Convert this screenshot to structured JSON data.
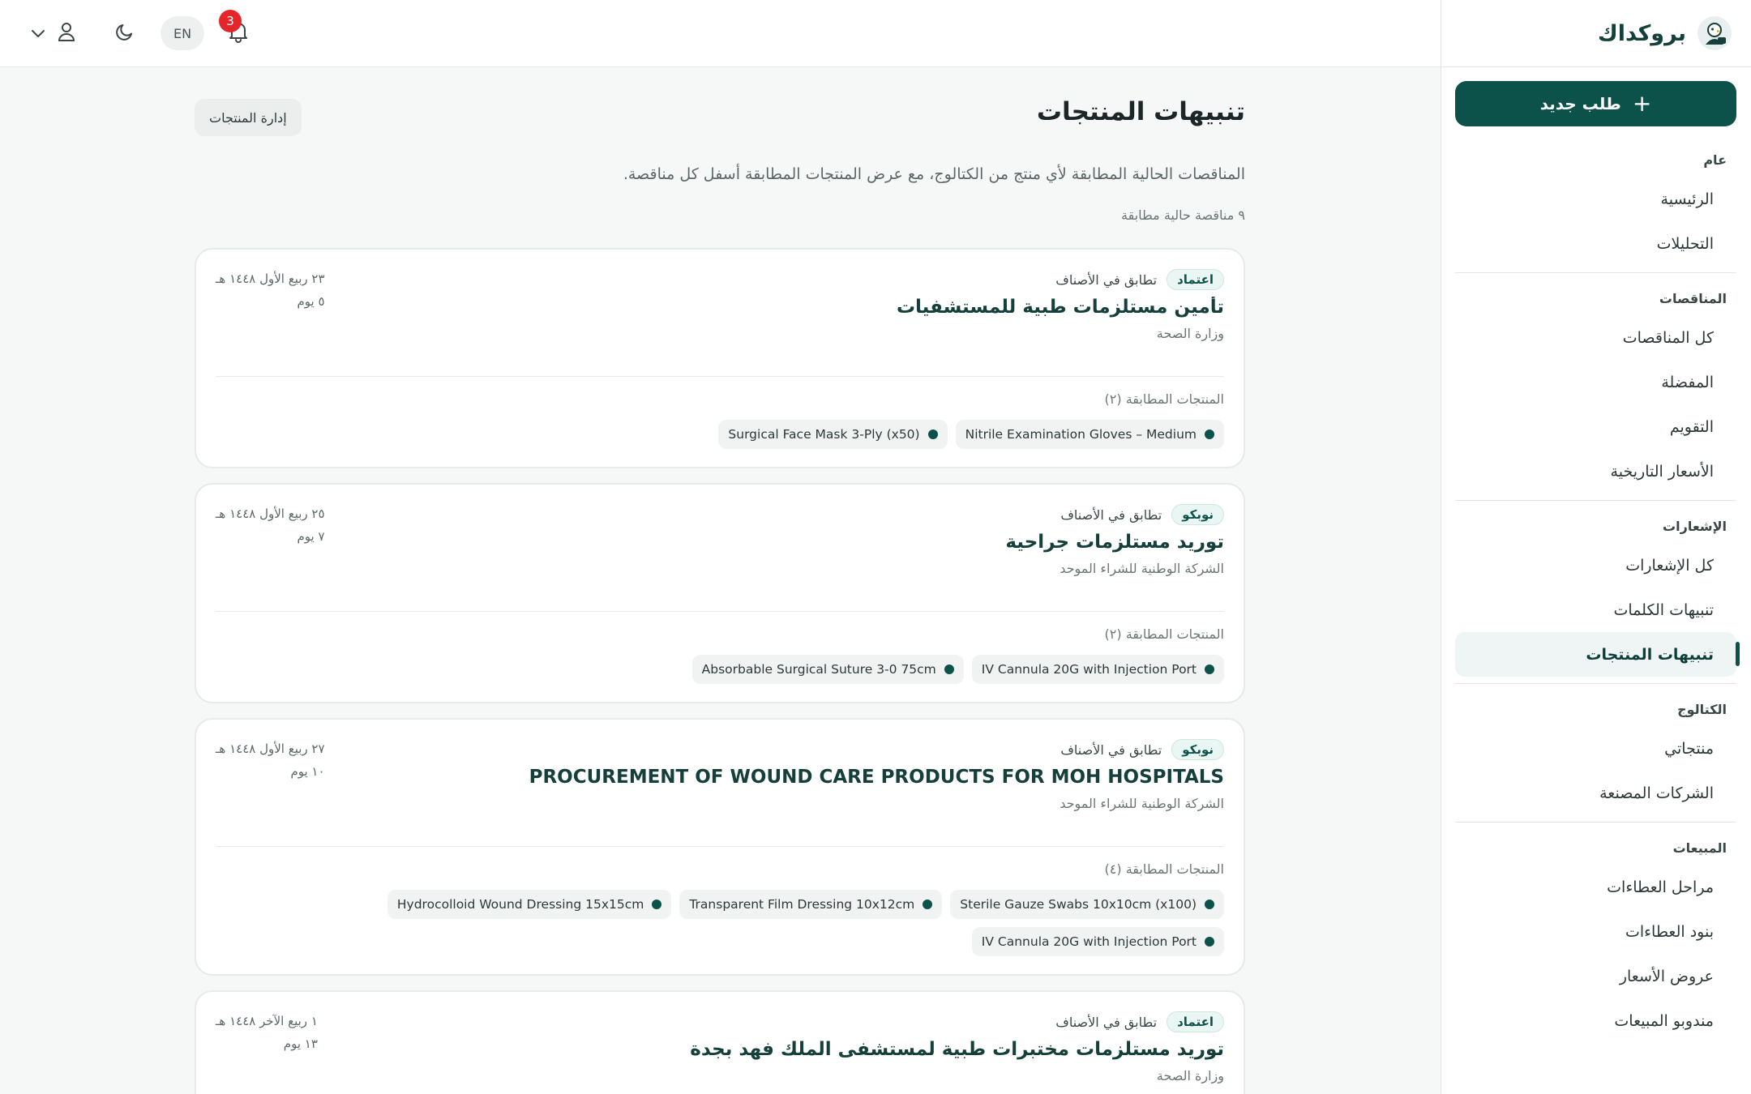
{
  "brand": {
    "name": "بروكداك"
  },
  "sidebar": {
    "new_request_label": "طلب جديد",
    "sections": [
      {
        "heading": "عام",
        "items": [
          "الرئيسية",
          "التحليلات"
        ]
      },
      {
        "heading": "المناقصات",
        "items": [
          "كل المناقصات",
          "المفضلة",
          "التقويم",
          "الأسعار التاريخية"
        ]
      },
      {
        "heading": "الإشعارات",
        "items": [
          "كل الإشعارات",
          "تنبيهات الكلمات",
          "تنبيهات المنتجات"
        ]
      },
      {
        "heading": "الكتالوج",
        "items": [
          "منتجاتي",
          "الشركات المصنعة"
        ]
      },
      {
        "heading": "المبيعات",
        "items": [
          "مراحل العطاءات",
          "بنود العطاءات",
          "عروض الأسعار",
          "مندوبو المبيعات"
        ]
      }
    ],
    "active_item": "تنبيهات المنتجات"
  },
  "topbar": {
    "notification_count": "3",
    "language": "EN"
  },
  "page": {
    "title": "تنبيهات المنتجات",
    "manage_button": "إدارة المنتجات",
    "description": "المناقصات الحالية المطابقة لأي منتج من الكتالوج، مع عرض المنتجات المطابقة أسفل كل مناقصة.",
    "match_count": "٩ مناقصة حالية مطابقة"
  },
  "tenders": [
    {
      "tag": "اعتماد",
      "match_type": "تطابق في الأصناف",
      "title": "تأمين مستلزمات طبية للمستشفيات",
      "org": "وزارة الصحة",
      "date": "٢٣ ربيع الأول ١٤٤٨ هـ",
      "days": "٥ يوم",
      "products_heading": "المنتجات المطابقة (٢)",
      "products": [
        "Nitrile Examination Gloves – Medium",
        "Surgical Face Mask 3-Ply (x50)"
      ]
    },
    {
      "tag": "نوبكو",
      "match_type": "تطابق في الأصناف",
      "title": "توريد مستلزمات جراحية",
      "org": "الشركة الوطنية للشراء الموحد",
      "date": "٢٥ ربيع الأول ١٤٤٨ هـ",
      "days": "٧ يوم",
      "products_heading": "المنتجات المطابقة (٢)",
      "products": [
        "IV Cannula 20G with Injection Port",
        "Absorbable Surgical Suture 3-0 75cm"
      ]
    },
    {
      "tag": "نوبكو",
      "match_type": "تطابق في الأصناف",
      "title": "PROCUREMENT OF WOUND CARE PRODUCTS FOR MOH HOSPITALS",
      "org": "الشركة الوطنية للشراء الموحد",
      "date": "٢٧ ربيع الأول ١٤٤٨ هـ",
      "days": "١٠ يوم",
      "products_heading": "المنتجات المطابقة (٤)",
      "products": [
        "Sterile Gauze Swabs 10x10cm (x100)",
        "Transparent Film Dressing 10x12cm",
        "Hydrocolloid Wound Dressing 15x15cm",
        "IV Cannula 20G with Injection Port"
      ]
    },
    {
      "tag": "اعتماد",
      "match_type": "تطابق في الأصناف",
      "title": "توريد مستلزمات مختبرات طبية لمستشفى الملك فهد بجدة",
      "org": "وزارة الصحة",
      "date": "١ ربيع الآخر ١٤٤٨ هـ",
      "days": "١٣ يوم",
      "products_heading": "",
      "products": []
    }
  ]
}
